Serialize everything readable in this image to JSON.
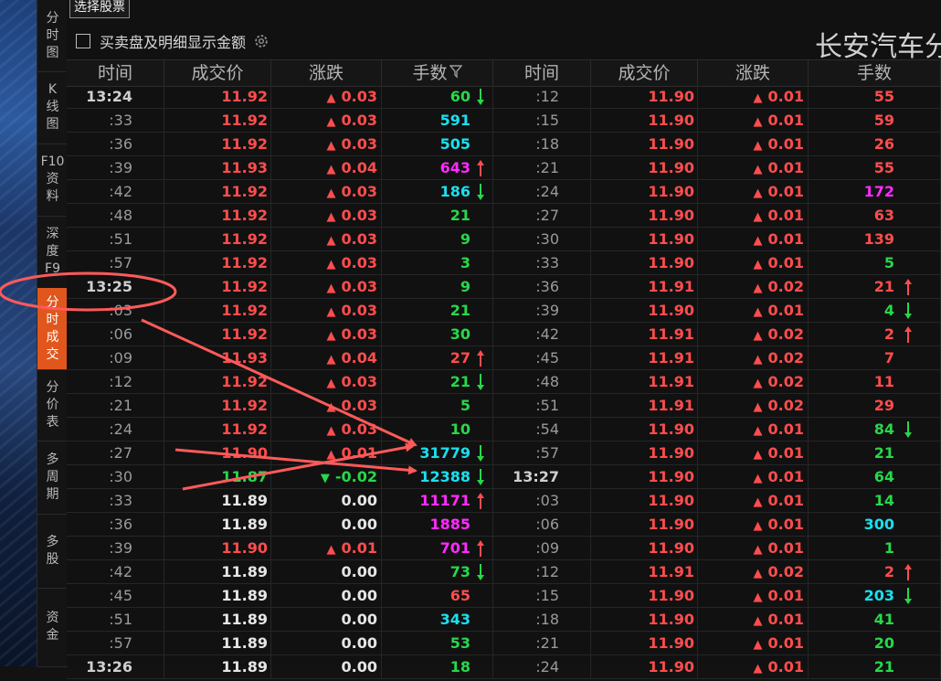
{
  "nav": {
    "items": [
      {
        "label": "分\n时\n图",
        "active": false
      },
      {
        "label": "K\n线\n图",
        "active": false
      },
      {
        "label": "F10\n资\n料",
        "active": false
      },
      {
        "label": "深\n度\nF9",
        "active": false
      },
      {
        "label": "分\n时\n成\n交",
        "active": true
      },
      {
        "label": "分\n价\n表",
        "active": false
      },
      {
        "label": "多\n周\n期",
        "active": false
      },
      {
        "label": "多\n股",
        "active": false
      },
      {
        "label": "资\n金",
        "active": false
      }
    ]
  },
  "toolbar": {
    "select_stock_label": "选择股票",
    "show_amount_label": "买卖盘及明细显示金额",
    "show_amount_checked": false
  },
  "stock": {
    "title": "长安汽车分"
  },
  "headers": [
    "时间",
    "成交价",
    "涨跌",
    "手数",
    "时间",
    "成交价",
    "涨跌",
    "手数"
  ],
  "colors": {
    "up": "#ff4d4d",
    "down": "#27d84a",
    "flat": "#e6e6e6",
    "large_vol": "#19e0f0",
    "huge_vol": "#ff2bff",
    "active_tab": "#e0561d",
    "annotation": "#ff5a5a"
  },
  "left": [
    {
      "time": "13:24",
      "price": "11.92",
      "change": "0.03",
      "dir": "up",
      "vol": "60",
      "vc": "green",
      "arrow": "down"
    },
    {
      "time": ":33",
      "price": "11.92",
      "change": "0.03",
      "dir": "up",
      "vol": "591",
      "vc": "cyan",
      "arrow": ""
    },
    {
      "time": ":36",
      "price": "11.92",
      "change": "0.03",
      "dir": "up",
      "vol": "505",
      "vc": "cyan",
      "arrow": ""
    },
    {
      "time": ":39",
      "price": "11.93",
      "change": "0.04",
      "dir": "up",
      "vol": "643",
      "vc": "mag",
      "arrow": "up"
    },
    {
      "time": ":42",
      "price": "11.92",
      "change": "0.03",
      "dir": "up",
      "vol": "186",
      "vc": "cyan",
      "arrow": "down"
    },
    {
      "time": ":48",
      "price": "11.92",
      "change": "0.03",
      "dir": "up",
      "vol": "21",
      "vc": "green",
      "arrow": ""
    },
    {
      "time": ":51",
      "price": "11.92",
      "change": "0.03",
      "dir": "up",
      "vol": "9",
      "vc": "green",
      "arrow": ""
    },
    {
      "time": ":57",
      "price": "11.92",
      "change": "0.03",
      "dir": "up",
      "vol": "3",
      "vc": "green",
      "arrow": ""
    },
    {
      "time": "13:25",
      "price": "11.92",
      "change": "0.03",
      "dir": "up",
      "vol": "9",
      "vc": "green",
      "arrow": ""
    },
    {
      "time": ":03",
      "price": "11.92",
      "change": "0.03",
      "dir": "up",
      "vol": "21",
      "vc": "green",
      "arrow": ""
    },
    {
      "time": ":06",
      "price": "11.92",
      "change": "0.03",
      "dir": "up",
      "vol": "30",
      "vc": "green",
      "arrow": ""
    },
    {
      "time": ":09",
      "price": "11.93",
      "change": "0.04",
      "dir": "up",
      "vol": "27",
      "vc": "red",
      "arrow": "up"
    },
    {
      "time": ":12",
      "price": "11.92",
      "change": "0.03",
      "dir": "up",
      "vol": "21",
      "vc": "green",
      "arrow": "down"
    },
    {
      "time": ":21",
      "price": "11.92",
      "change": "0.03",
      "dir": "up",
      "vol": "5",
      "vc": "green",
      "arrow": ""
    },
    {
      "time": ":24",
      "price": "11.92",
      "change": "0.03",
      "dir": "up",
      "vol": "10",
      "vc": "green",
      "arrow": ""
    },
    {
      "time": ":27",
      "price": "11.90",
      "change": "0.01",
      "dir": "up",
      "vol": "31779",
      "vc": "cyan",
      "arrow": "down"
    },
    {
      "time": ":30",
      "price": "11.87",
      "change": "-0.02",
      "dir": "down",
      "vol": "12388",
      "vc": "cyan",
      "arrow": "down"
    },
    {
      "time": ":33",
      "price": "11.89",
      "change": "0.00",
      "dir": "flat",
      "vol": "11171",
      "vc": "mag",
      "arrow": "up"
    },
    {
      "time": ":36",
      "price": "11.89",
      "change": "0.00",
      "dir": "flat",
      "vol": "1885",
      "vc": "mag",
      "arrow": ""
    },
    {
      "time": ":39",
      "price": "11.90",
      "change": "0.01",
      "dir": "up",
      "vol": "701",
      "vc": "mag",
      "arrow": "up"
    },
    {
      "time": ":42",
      "price": "11.89",
      "change": "0.00",
      "dir": "flat",
      "vol": "73",
      "vc": "green",
      "arrow": "down"
    },
    {
      "time": ":45",
      "price": "11.89",
      "change": "0.00",
      "dir": "flat",
      "vol": "65",
      "vc": "red",
      "arrow": ""
    },
    {
      "time": ":51",
      "price": "11.89",
      "change": "0.00",
      "dir": "flat",
      "vol": "343",
      "vc": "cyan",
      "arrow": ""
    },
    {
      "time": ":57",
      "price": "11.89",
      "change": "0.00",
      "dir": "flat",
      "vol": "53",
      "vc": "green",
      "arrow": ""
    },
    {
      "time": "13:26",
      "price": "11.89",
      "change": "0.00",
      "dir": "flat",
      "vol": "18",
      "vc": "green",
      "arrow": ""
    }
  ],
  "right": [
    {
      "time": ":12",
      "price": "11.90",
      "change": "0.01",
      "dir": "up",
      "vol": "55",
      "vc": "red",
      "arrow": ""
    },
    {
      "time": ":15",
      "price": "11.90",
      "change": "0.01",
      "dir": "up",
      "vol": "59",
      "vc": "red",
      "arrow": ""
    },
    {
      "time": ":18",
      "price": "11.90",
      "change": "0.01",
      "dir": "up",
      "vol": "26",
      "vc": "red",
      "arrow": ""
    },
    {
      "time": ":21",
      "price": "11.90",
      "change": "0.01",
      "dir": "up",
      "vol": "55",
      "vc": "red",
      "arrow": ""
    },
    {
      "time": ":24",
      "price": "11.90",
      "change": "0.01",
      "dir": "up",
      "vol": "172",
      "vc": "mag",
      "arrow": ""
    },
    {
      "time": ":27",
      "price": "11.90",
      "change": "0.01",
      "dir": "up",
      "vol": "63",
      "vc": "red",
      "arrow": ""
    },
    {
      "time": ":30",
      "price": "11.90",
      "change": "0.01",
      "dir": "up",
      "vol": "139",
      "vc": "red",
      "arrow": ""
    },
    {
      "time": ":33",
      "price": "11.90",
      "change": "0.01",
      "dir": "up",
      "vol": "5",
      "vc": "green",
      "arrow": ""
    },
    {
      "time": ":36",
      "price": "11.91",
      "change": "0.02",
      "dir": "up",
      "vol": "21",
      "vc": "red",
      "arrow": "up"
    },
    {
      "time": ":39",
      "price": "11.90",
      "change": "0.01",
      "dir": "up",
      "vol": "4",
      "vc": "green",
      "arrow": "down"
    },
    {
      "time": ":42",
      "price": "11.91",
      "change": "0.02",
      "dir": "up",
      "vol": "2",
      "vc": "red",
      "arrow": "up"
    },
    {
      "time": ":45",
      "price": "11.91",
      "change": "0.02",
      "dir": "up",
      "vol": "7",
      "vc": "red",
      "arrow": ""
    },
    {
      "time": ":48",
      "price": "11.91",
      "change": "0.02",
      "dir": "up",
      "vol": "11",
      "vc": "red",
      "arrow": ""
    },
    {
      "time": ":51",
      "price": "11.91",
      "change": "0.02",
      "dir": "up",
      "vol": "29",
      "vc": "red",
      "arrow": ""
    },
    {
      "time": ":54",
      "price": "11.90",
      "change": "0.01",
      "dir": "up",
      "vol": "84",
      "vc": "green",
      "arrow": "down"
    },
    {
      "time": ":57",
      "price": "11.90",
      "change": "0.01",
      "dir": "up",
      "vol": "21",
      "vc": "green",
      "arrow": ""
    },
    {
      "time": "13:27",
      "price": "11.90",
      "change": "0.01",
      "dir": "up",
      "vol": "64",
      "vc": "green",
      "arrow": ""
    },
    {
      "time": ":03",
      "price": "11.90",
      "change": "0.01",
      "dir": "up",
      "vol": "14",
      "vc": "green",
      "arrow": ""
    },
    {
      "time": ":06",
      "price": "11.90",
      "change": "0.01",
      "dir": "up",
      "vol": "300",
      "vc": "cyan",
      "arrow": ""
    },
    {
      "time": ":09",
      "price": "11.90",
      "change": "0.01",
      "dir": "up",
      "vol": "1",
      "vc": "green",
      "arrow": ""
    },
    {
      "time": ":12",
      "price": "11.91",
      "change": "0.02",
      "dir": "up",
      "vol": "2",
      "vc": "red",
      "arrow": "up"
    },
    {
      "time": ":15",
      "price": "11.90",
      "change": "0.01",
      "dir": "up",
      "vol": "203",
      "vc": "cyan",
      "arrow": "down"
    },
    {
      "time": ":18",
      "price": "11.90",
      "change": "0.01",
      "dir": "up",
      "vol": "41",
      "vc": "green",
      "arrow": ""
    },
    {
      "time": ":21",
      "price": "11.90",
      "change": "0.01",
      "dir": "up",
      "vol": "20",
      "vc": "green",
      "arrow": ""
    },
    {
      "time": ":24",
      "price": "11.90",
      "change": "0.01",
      "dir": "up",
      "vol": "21",
      "vc": "green",
      "arrow": ""
    }
  ]
}
